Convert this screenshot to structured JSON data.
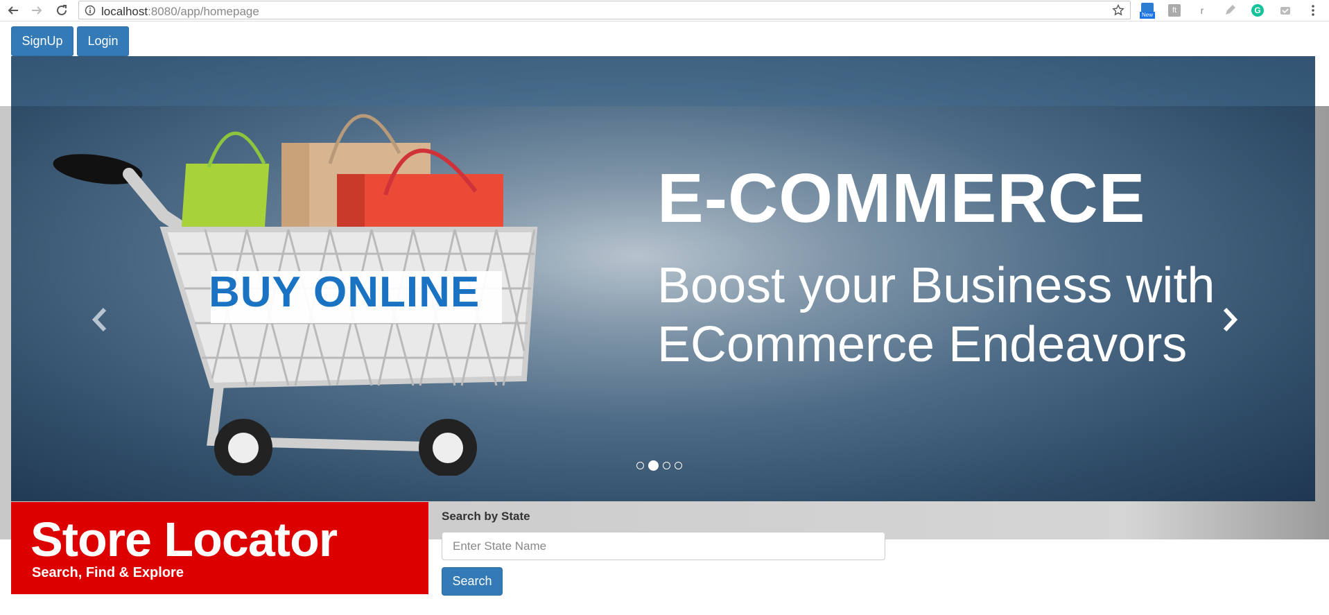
{
  "browser": {
    "url_host": "localhost",
    "url_path": ":8080/app/homepage",
    "extension_new_badge": "New",
    "extension_letter": "r"
  },
  "header": {
    "signup_label": "SignUp",
    "login_label": "Login"
  },
  "carousel": {
    "headline": "E-COMMERCE",
    "tagline_line1": "Boost your Business with",
    "tagline_line2": "ECommerce Endeavors",
    "cart_label": "BUY ONLINE",
    "slide_count": 4,
    "active_slide": 2
  },
  "store_locator": {
    "title": "Store Locator",
    "subtitle": "Search, Find & Explore"
  },
  "search": {
    "label": "Search by State",
    "placeholder": "Enter State Name",
    "button_label": "Search"
  },
  "colors": {
    "primary": "#337ab7",
    "store_red": "#dd0000"
  }
}
